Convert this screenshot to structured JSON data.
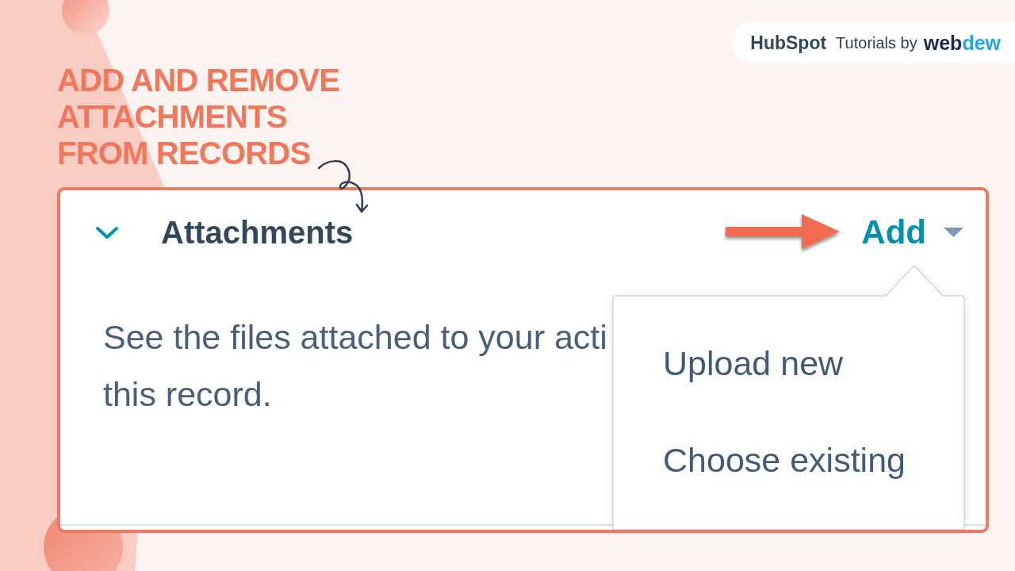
{
  "logo_bar": {
    "brand": "HubSpot",
    "tagline": "Tutorials by",
    "partner_parts": [
      "web",
      "dew"
    ]
  },
  "title_lines": [
    "ADD AND REMOVE",
    "ATTACHMENTS",
    "FROM RECORDS"
  ],
  "card": {
    "heading": "Attachments",
    "expanded": true,
    "add_button": {
      "label": "Add",
      "menu_open": true
    },
    "description_lines": [
      "See the files attached to your acti",
      "this record."
    ],
    "menu": [
      {
        "label": "Upload new"
      },
      {
        "label": "Choose existing"
      }
    ]
  }
}
